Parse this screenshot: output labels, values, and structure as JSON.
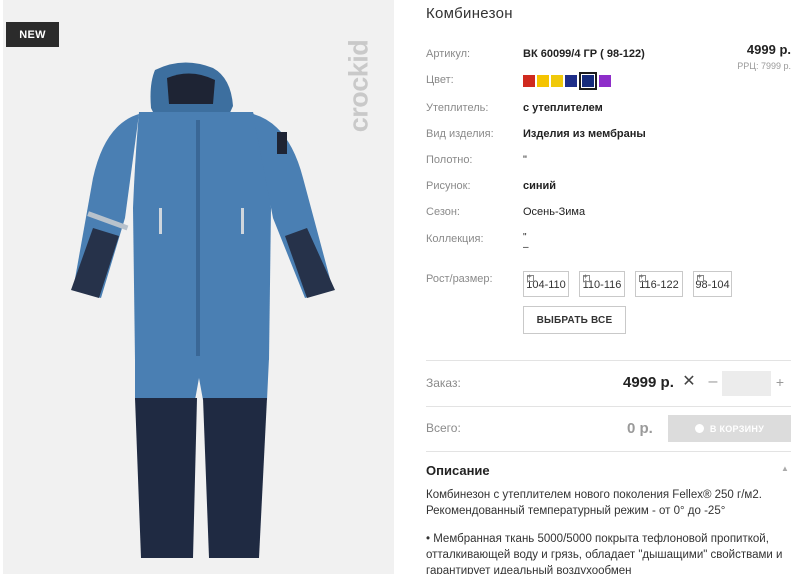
{
  "badge": "NEW",
  "brand_logo": "crockid",
  "product": {
    "title": "Комбинезон",
    "price": "4999 р.",
    "rrc": "РРЦ: 7999 р."
  },
  "specs": {
    "article_label": "Артикул:",
    "article_value": "ВК 60099/4 ГР ( 98-122)",
    "color_label": "Цвет:",
    "insulation_label": "Утеплитель:",
    "insulation_value": "с утеплителем",
    "type_label": "Вид изделия:",
    "type_value": "Изделия из мембраны",
    "fabric_label": "Полотно:",
    "fabric_value": "\"",
    "pattern_label": "Рисунок:",
    "pattern_value": "синий",
    "season_label": "Сезон:",
    "season_value": "Осень-Зима",
    "collection_label": "Коллекция:",
    "collection_value_1": "\"",
    "collection_value_2": "–",
    "size_label": "Рост/размер:"
  },
  "colors": [
    "#d02a1f",
    "#f5c400",
    "#f0c90a",
    "#1f2f8a",
    "#152a7a",
    "#8e2ec9"
  ],
  "selected_color_index": 4,
  "sizes": [
    "104-110",
    "110-116",
    "116-122",
    "98-104"
  ],
  "select_all_label": "ВЫБРАТЬ ВСЕ",
  "order": {
    "label": "Заказ:",
    "price": "4999 р.",
    "remove_icon": "✕",
    "minus": "–",
    "plus": "+",
    "qty": ""
  },
  "total": {
    "label": "Всего:",
    "value": "0 р.",
    "cart_label": "В КОРЗИНУ"
  },
  "description": {
    "title": "Описание",
    "caret": "▲",
    "p1_line1": "Комбинезон с утеплителем нового поколения Fellex® 250 г/м2.",
    "p1_line2": "Рекомендованный температурный режим - от 0° до -25°",
    "p2_line1": "• Мембранная ткань 5000/5000 покрыта тефлоновой пропиткой,",
    "p2_line2": "отталкивающей воду и грязь, обладает \"дышащими\" свойствами и",
    "p2_line3": "гарантирует идеальный воздухообмен"
  }
}
